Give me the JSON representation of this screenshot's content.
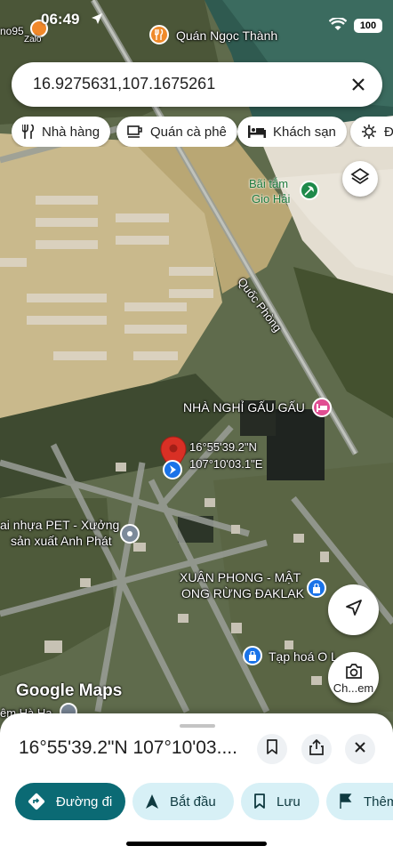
{
  "status_bar": {
    "time": "06:49",
    "battery": "100",
    "top_left_text": "no95",
    "zalo_label": "Zalo"
  },
  "search": {
    "query": "16.9275631,107.1675261"
  },
  "chips": [
    {
      "label": "Nhà hàng",
      "icon": "fork-knife-icon"
    },
    {
      "label": "Quán cà phê",
      "icon": "coffee-icon"
    },
    {
      "label": "Khách sạn",
      "icon": "bed-icon"
    },
    {
      "label": "Đị",
      "icon": "camera-icon"
    }
  ],
  "map": {
    "labels": {
      "quan_ngoc_thanh": "Quán Ngọc Thành",
      "bai_tam": "Bãi tắm",
      "gio_hai": "Gio Hải",
      "quoc_phong": "Quốc Phòng",
      "nha_nghi": "NHÀ NGHỈ GẤU GẤU",
      "coord_lat": "16°55'39.2\"N",
      "coord_lng": "107°10'03.1\"E",
      "xuong_1": "ai nhựa PET - Xưởng",
      "xuong_2": "sản xuất Anh Phát",
      "xuan_phong_1": "XUÂN PHONG - MẬT",
      "xuan_phong_2": "ONG RỪNG ĐAKLAK",
      "tap_hoa": "Tạp hoá O L",
      "em_ha": "êm Hà Hạ",
      "chem_button": "Ch...em"
    },
    "logo": "Google Maps",
    "accent_red": "#d93025"
  },
  "sheet": {
    "title": "16°55'39.2\"N 107°10'03....",
    "actions": [
      {
        "label": "Đường đi",
        "icon": "directions-icon",
        "primary": true
      },
      {
        "label": "Bắt đầu",
        "icon": "navigation-arrow-icon",
        "primary": false
      },
      {
        "label": "Lưu",
        "icon": "bookmark-icon",
        "primary": false
      },
      {
        "label": "Thêm",
        "icon": "flag-icon",
        "primary": false
      }
    ],
    "primary_color": "#0b6a74",
    "secondary_bg": "#d7f0f6"
  }
}
